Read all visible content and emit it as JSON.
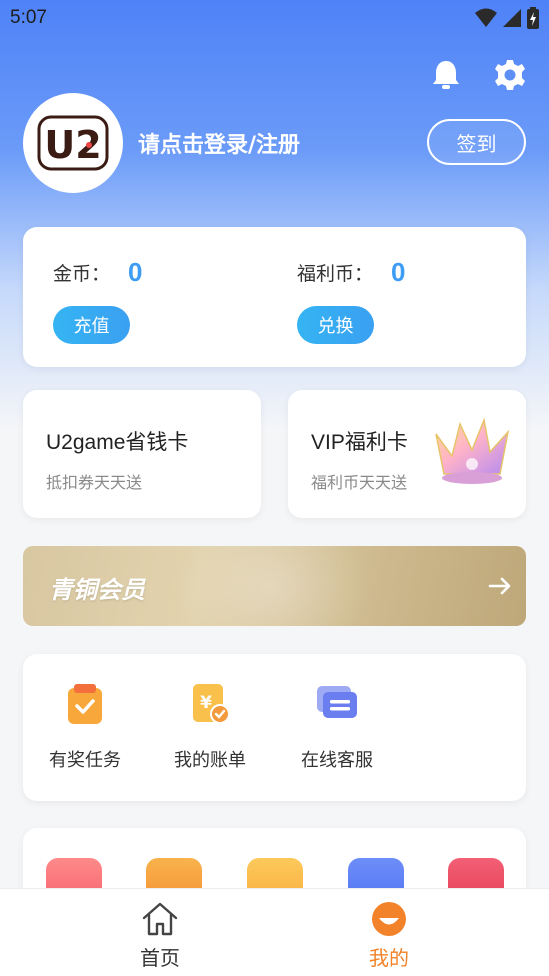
{
  "status_bar": {
    "time": "5:07"
  },
  "header": {
    "avatar_text": "U2",
    "login_prompt": "请点击登录/注册",
    "checkin_label": "签到"
  },
  "wallet": {
    "gold": {
      "label": "金币：",
      "value": "0",
      "action": "充值"
    },
    "welfare": {
      "label": "福利币：",
      "value": "0",
      "action": "兑换"
    }
  },
  "feature_cards": [
    {
      "title": "U2game省钱卡",
      "subtitle": "抵扣券天天送"
    },
    {
      "title": "VIP福利卡",
      "subtitle": "福利币天天送"
    }
  ],
  "membership": {
    "title": "青铜会员"
  },
  "tools": [
    {
      "label": "有奖任务",
      "icon": "task-clipboard-icon"
    },
    {
      "label": "我的账单",
      "icon": "bill-icon"
    },
    {
      "label": "在线客服",
      "icon": "chat-icon"
    }
  ],
  "more_icons": [
    "gift-icon",
    "ticket-icon",
    "coupon-icon",
    "shield-icon",
    "game-icon"
  ],
  "tabbar": {
    "home": {
      "label": "首页",
      "icon": "home-icon",
      "active": false
    },
    "mine": {
      "label": "我的",
      "icon": "mine-face-icon",
      "active": true
    }
  },
  "colors": {
    "accent_blue": "#3d9df5",
    "active_tab": "#f2832a",
    "hero_top": "#4f82f7"
  }
}
